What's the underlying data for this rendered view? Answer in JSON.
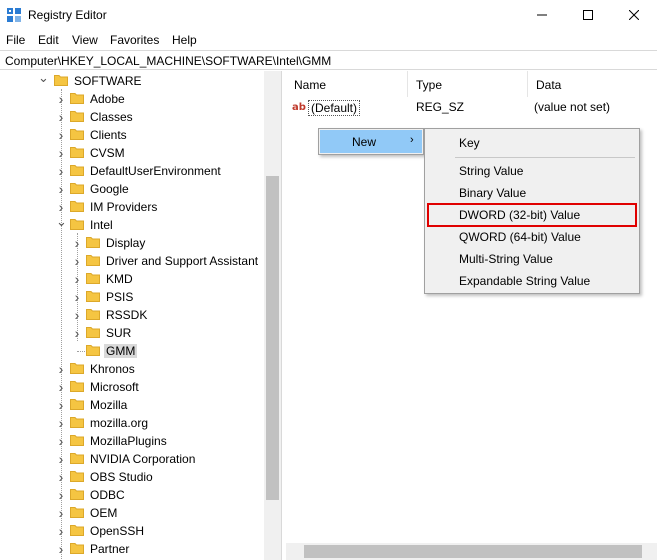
{
  "window": {
    "title": "Registry Editor",
    "minimize_glyph": "—",
    "maximize_glyph": "☐",
    "close_glyph": "✕"
  },
  "menu": {
    "file": "File",
    "edit": "Edit",
    "view": "View",
    "favorites": "Favorites",
    "help": "Help"
  },
  "address": "Computer\\HKEY_LOCAL_MACHINE\\SOFTWARE\\Intel\\GMM",
  "tree": {
    "root": "SOFTWARE",
    "children": [
      "Adobe",
      "Classes",
      "Clients",
      "CVSM",
      "DefaultUserEnvironment",
      "Google",
      "IM Providers"
    ],
    "intel": "Intel",
    "intel_children": [
      "Display",
      "Driver and Support Assistant",
      "KMD",
      "PSIS",
      "RSSDK",
      "SUR",
      "GMM"
    ],
    "after_intel": [
      "Khronos",
      "Microsoft",
      "Mozilla",
      "mozilla.org",
      "MozillaPlugins",
      "NVIDIA Corporation",
      "OBS Studio",
      "ODBC",
      "OEM",
      "OpenSSH",
      "Partner"
    ],
    "selected": "GMM"
  },
  "list": {
    "columns": [
      "Name",
      "Type",
      "Data"
    ],
    "rows": [
      {
        "name": "(Default)",
        "type": "REG_SZ",
        "data": "(value not set)"
      }
    ]
  },
  "context_menu": {
    "new_label": "New",
    "arrow": "›"
  },
  "submenu": {
    "items": [
      "Key",
      "String Value",
      "Binary Value",
      "DWORD (32-bit) Value",
      "QWORD (64-bit) Value",
      "Multi-String Value",
      "Expandable String Value"
    ],
    "highlighted": "DWORD (32-bit) Value"
  },
  "colors": {
    "folder": "#f5c542",
    "folder_dark": "#dca82a",
    "menu_hover": "#91c9f7",
    "highlight_border": "#e00000",
    "selection": "#d9d9d9"
  }
}
